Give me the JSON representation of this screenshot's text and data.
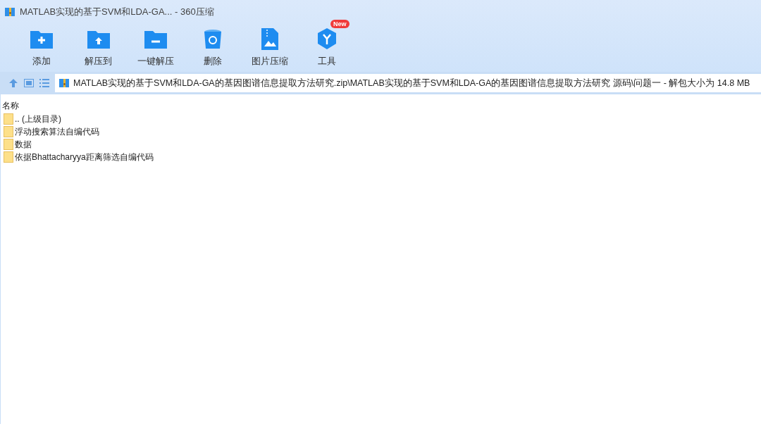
{
  "window": {
    "title": "MATLAB实现的基于SVM和LDA-GA... - 360压缩"
  },
  "toolbar": [
    {
      "kind": "add",
      "label": "添加"
    },
    {
      "kind": "extract",
      "label": "解压到"
    },
    {
      "kind": "quick",
      "label": "一键解压"
    },
    {
      "kind": "delete",
      "label": "删除"
    },
    {
      "kind": "image",
      "label": "图片压缩"
    },
    {
      "kind": "tools",
      "label": "工具",
      "badge": "New"
    }
  ],
  "address": {
    "path": "MATLAB实现的基于SVM和LDA-GA的基因图谱信息提取方法研究.zip\\MATLAB实现的基于SVM和LDA-GA的基因图谱信息提取方法研究 源码\\问题一 - 解包大小为 14.8 MB"
  },
  "table": {
    "columns": [
      "名称"
    ],
    "rows": [
      {
        "name": ".. (上级目录)"
      },
      {
        "name": "浮动搜索算法自编代码"
      },
      {
        "name": "数据"
      },
      {
        "name": "依据Bhattacharyya距离筛选自编代码"
      }
    ]
  }
}
